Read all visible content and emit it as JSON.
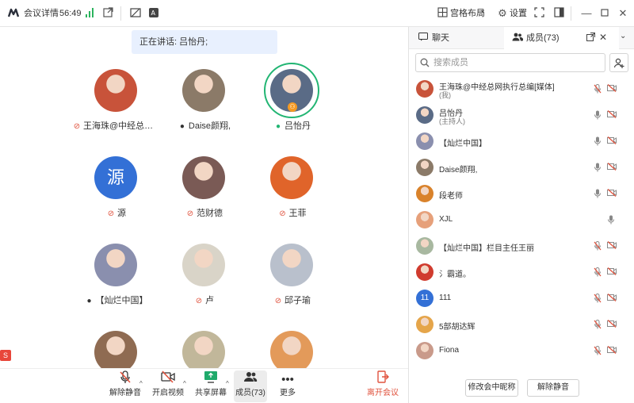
{
  "topbar": {
    "meeting_info": "会议详情",
    "timer": "56:49",
    "layout_label": "宫格布局",
    "settings_label": "设置"
  },
  "speaker_banner": "正在讲话: 吕怡丹;",
  "tiles": [
    {
      "name": "王海珠@中经总网...",
      "mic": "muted",
      "avatar_color": "#c8533a"
    },
    {
      "name": "Daise颜翔,",
      "mic": "on",
      "avatar_color": "#8b7a68"
    },
    {
      "name": "吕怡丹",
      "mic": "speaking",
      "avatar_color": "#5a6b86",
      "speaking": true,
      "host": true
    },
    {
      "name": "源",
      "mic": "muted",
      "avatar_text": "源",
      "avatar_color": "#3370d6"
    },
    {
      "name": "范财德",
      "mic": "muted",
      "avatar_color": "#7a5a55"
    },
    {
      "name": "王菲",
      "mic": "muted",
      "avatar_color": "#e0642a"
    },
    {
      "name": "【灿烂中国】",
      "mic": "on",
      "avatar_color": "#8a8fae"
    },
    {
      "name": "卢",
      "mic": "muted",
      "avatar_color": "#d9d4c8"
    },
    {
      "name": "邱子瑜",
      "mic": "muted",
      "avatar_color": "#b9c0cc"
    },
    {
      "name": "",
      "mic": "",
      "avatar_color": "#8f6b52"
    },
    {
      "name": "",
      "mic": "",
      "avatar_color": "#c1b79a"
    },
    {
      "name": "",
      "mic": "",
      "avatar_color": "#e39a5a"
    }
  ],
  "toolbar": {
    "unmute": "解除静音",
    "video": "开启视频",
    "share": "共享屏幕",
    "members": "成员(73)",
    "more": "更多",
    "leave": "离开会议"
  },
  "panel": {
    "tab_chat": "聊天",
    "tab_members": "成员(73)",
    "search_placeholder": "搜索成员",
    "btn_rename": "修改会中昵称",
    "btn_unmute": "解除静音"
  },
  "members": [
    {
      "name": "王海珠@中经总网执行总编[媒体]",
      "sub": "(我)",
      "mic": "muted",
      "cam": "off",
      "avatar_color": "#c8533a"
    },
    {
      "name": "吕怡丹",
      "sub": "(主持人)",
      "mic": "on",
      "cam": "off",
      "avatar_color": "#5a6b86"
    },
    {
      "name": "【灿烂中国】",
      "sub": "",
      "mic": "on",
      "cam": "off",
      "avatar_color": "#8a8fae"
    },
    {
      "name": "Daise颜翔,",
      "sub": "",
      "mic": "on",
      "cam": "off",
      "avatar_color": "#8b7a68"
    },
    {
      "name": "段老师",
      "sub": "",
      "mic": "on",
      "cam": "off",
      "avatar_color": "#d9822b"
    },
    {
      "name": "XJL",
      "sub": "",
      "mic": "on",
      "cam": "",
      "avatar_color": "#e6a07a"
    },
    {
      "name": "【灿烂中国】栏目主任王丽",
      "sub": "",
      "mic": "muted",
      "cam": "off",
      "avatar_color": "#a8b8a0"
    },
    {
      "name": "氵霸道。",
      "sub": "",
      "mic": "muted",
      "cam": "off",
      "avatar_color": "#d03b2e"
    },
    {
      "name": "111",
      "sub": "",
      "mic": "muted",
      "cam": "off",
      "avatar_text": "11",
      "avatar_color": "#3370d6"
    },
    {
      "name": "5部胡达辉",
      "sub": "",
      "mic": "muted",
      "cam": "off",
      "avatar_color": "#e5a54a"
    },
    {
      "name": "Fiona",
      "sub": "",
      "mic": "muted",
      "cam": "off",
      "avatar_color": "#c99a8a"
    }
  ]
}
